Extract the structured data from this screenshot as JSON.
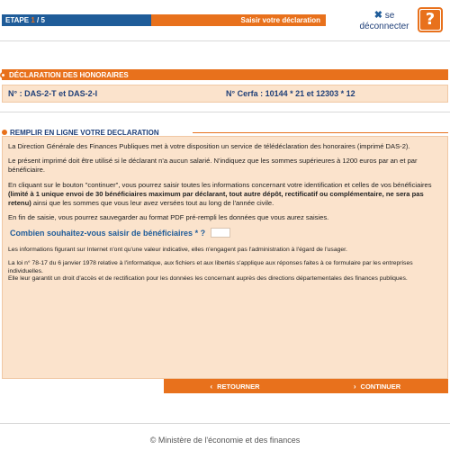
{
  "stepbar": {
    "etape_label": "ETAPE",
    "current_step": "1",
    "total_steps": "/ 5",
    "step_title": "Saisir votre déclaration"
  },
  "header": {
    "logout_mark": "✖",
    "logout_line1": "se",
    "logout_line2": "déconnecter",
    "help_glyph": "?"
  },
  "honoraires": {
    "title": "DÉCLARATION DES HONORAIRES",
    "numero": "N° : DAS-2-T et DAS-2-I",
    "cerfa": "N° Cerfa : 10144 * 21 et 12303 * 12"
  },
  "remplir": {
    "title": "REMPLIR EN LIGNE VOTRE DECLARATION",
    "p1": "La Direction Générale des Finances Publiques met à votre disposition un service de télédéclaration des honoraires (imprimé DAS-2).",
    "p2": "Le présent imprimé doit être utilisé si le déclarant n'a aucun salarié. N'indiquez que les sommes supérieures à 1200 euros par an et par bénéficiaire.",
    "p3a": "En cliquant sur le bouton \"continuer\", vous pourrez saisir toutes les informations concernant votre identification et celles de vos bénéficiaires ",
    "p3b": "(limité à 1 unique envoi de 30 bénéficiaires maximum par déclarant, tout autre dépôt, rectificatif ou complémentaire, ne sera pas retenu)",
    "p3c": " ainsi que les sommes que vous leur avez versées tout au long de l'année civile.",
    "p4": "En fin de saisie, vous pourrez sauvegarder au format PDF pré-rempli les données que vous aurez saisies.",
    "question": "Combien souhaitez-vous saisir de bénéficiaires *  ?",
    "info1": "Les informations figurant sur Internet n'ont qu'une valeur indicative, elles n'engagent pas l'administration à l'égard de l'usager.",
    "info2": "La loi n° 78-17 du 6 janvier 1978 relative à l'informatique, aux fichiers et aux libertés s'applique aux réponses faites à ce formulaire par les entreprises individuelles.",
    "info3": "Elle leur garantit un droit d'accès et de rectification pour les données les concernant auprès des directions départementales des finances publiques."
  },
  "nav": {
    "back": "RETOURNER",
    "next": "CONTINUER",
    "back_icon": "‹",
    "next_icon": "›"
  },
  "footer": {
    "text": "© Ministère de l'économie et des finances"
  },
  "colors": {
    "orange": "#e8711c",
    "blue": "#1f5c99",
    "panel": "#fbe3cc"
  }
}
